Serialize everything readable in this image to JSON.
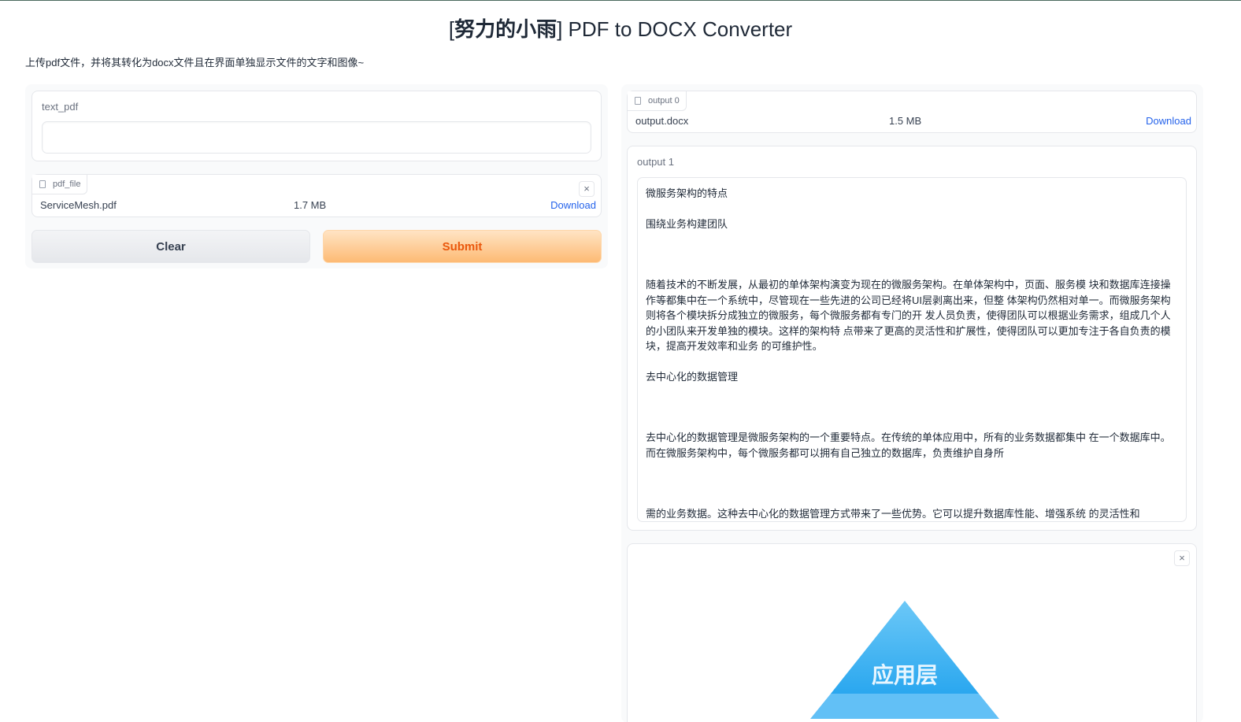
{
  "header": {
    "title_open": "[",
    "title_bold": "努力的小雨",
    "title_rest": "] PDF to DOCX Converter",
    "description": "上传pdf文件，并将其转化为docx文件且在界面单独显示文件的文字和图像~"
  },
  "inputs": {
    "text_label": "text_pdf",
    "text_value": "",
    "file_label": "pdf_file",
    "file_name": "ServiceMesh.pdf",
    "file_size": "1.7 MB",
    "file_download": "Download",
    "close_glyph": "×"
  },
  "buttons": {
    "clear": "Clear",
    "submit": "Submit"
  },
  "outputs": {
    "out0_label": "output 0",
    "out0_name": "output.docx",
    "out0_size": "1.5 MB",
    "out0_download": "Download",
    "out1_label": "output 1",
    "out1_paragraphs": [
      "微服务架构的特点",
      "围绕业务构建团队",
      "随着技术的不断发展，从最初的单体架构演变为现在的微服务架构。在单体架构中，页面、服务模 块和数据库连接操作等都集中在一个系统中，尽管现在一些先进的公司已经将UI层剥离出来，但整 体架构仍然相对单一。而微服务架构则将各个模块拆分成独立的微服务，每个微服务都有专门的开 发人员负责，使得团队可以根据业务需求，组成几个人的小团队来开发单独的模块。这样的架构特 点带来了更高的灵活性和扩展性，使得团队可以更加专注于各自负责的模块，提高开发效率和业务 的可维护性。",
      "去中心化的数据管理",
      "去中心化的数据管理是微服务架构的一个重要特点。在传统的单体应用中，所有的业务数据都集中 在一个数据库中。而在微服务架构中，每个微服务都可以拥有自己独立的数据库，负责维护自身所",
      "需的业务数据。这种去中心化的数据管理方式带来了一些优势。它可以提升数据库性能、增强系统 的灵活性和"
    ],
    "image_text": "应用层",
    "image_close": "×"
  },
  "colors": {
    "accent_orange": "#ea580c",
    "link_blue": "#2563eb",
    "pyramid_blue": "#4ab8f5"
  }
}
